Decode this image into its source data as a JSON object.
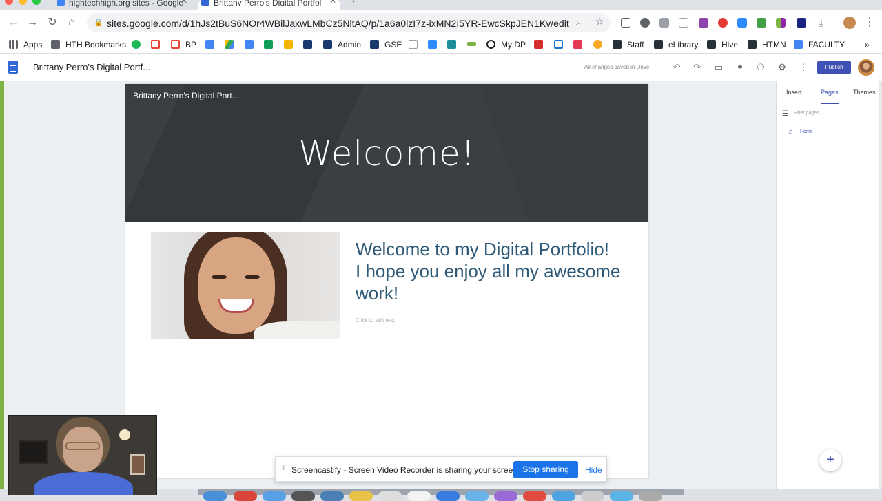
{
  "browser": {
    "tabs": [
      {
        "title": "hightechhigh.org sites - Google"
      },
      {
        "title": "Brittany Perro's Digital Portfolio"
      }
    ],
    "url": "sites.google.com/d/1hJs2tBuS6NOr4WBilJaxwLMbCz5NltAQ/p/1a6a0lzI7z-ixMN2I5YR-EwcSkpJEN1Kv/edit",
    "bookmarks": [
      {
        "label": "Apps"
      },
      {
        "label": "HTH Bookmarks"
      },
      {
        "label": "BP"
      },
      {
        "label": "Admin"
      },
      {
        "label": "GSE"
      },
      {
        "label": "My DP"
      },
      {
        "label": "Staff"
      },
      {
        "label": "eLibrary"
      },
      {
        "label": "Hive"
      },
      {
        "label": "HTMN"
      },
      {
        "label": "FACULTY"
      }
    ],
    "more_bookmarks": "»"
  },
  "app": {
    "title": "Brittany Perro's Digital Portf...",
    "save_status": "All changes saved in Drive",
    "publish_label": "Publish"
  },
  "site": {
    "name": "Brittany Perro's Digital Port...",
    "header_title": "Welcome!",
    "hero_line1": "Welcome to my Digital Portfolio!",
    "hero_line2": "I hope you enjoy all my awesome",
    "hero_line3": "work!",
    "edit_hint": "Click to edit text"
  },
  "panel": {
    "tabs": [
      "Insert",
      "Pages",
      "Themes"
    ],
    "active_tab": "Pages",
    "filter_placeholder": "Filter pages",
    "pages": [
      "Home"
    ],
    "add_symbol": "+"
  },
  "screencastify": {
    "message": "Screencastify - Screen Video Recorder is sharing your screen.",
    "stop_label": "Stop sharing",
    "hide_label": "Hide"
  },
  "colors": {
    "accent": "#3f51b5",
    "header_bg": "#3b3e42",
    "hero_text": "#2e5a78",
    "stop_button": "#1a73e8"
  }
}
